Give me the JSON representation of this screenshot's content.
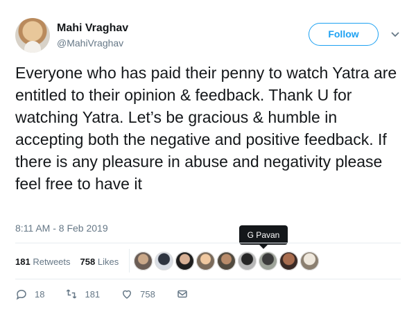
{
  "profile": {
    "name": "Mahi Vraghav",
    "handle": "@MahiVraghav",
    "follow_label": "Follow"
  },
  "tweet": {
    "text": "Everyone who has paid their penny to watch Yatra are entitled to their opinion & feedback. Thank U for watching Yatra. Let’s be gracious & humble in accepting both the negative and positive feedback. If there is any pleasure in abuse and negativity please feel free to have it",
    "timestamp": "8:11 AM - 8 Feb 2019"
  },
  "tooltip": "G Pavan",
  "stats": {
    "retweets_count": "181",
    "retweets_label": "Retweets",
    "likes_count": "758",
    "likes_label": "Likes"
  },
  "actions": {
    "replies": "18",
    "retweets": "181",
    "likes": "758"
  },
  "icons": {
    "reply": "reply-icon",
    "retweet": "retweet-icon",
    "like": "heart-icon",
    "message": "message-icon",
    "more": "chevron-down-icon"
  },
  "colors": {
    "accent": "#1da1f2",
    "text_primary": "#14171a",
    "text_secondary": "#657786",
    "divider": "#e6ecf0"
  }
}
